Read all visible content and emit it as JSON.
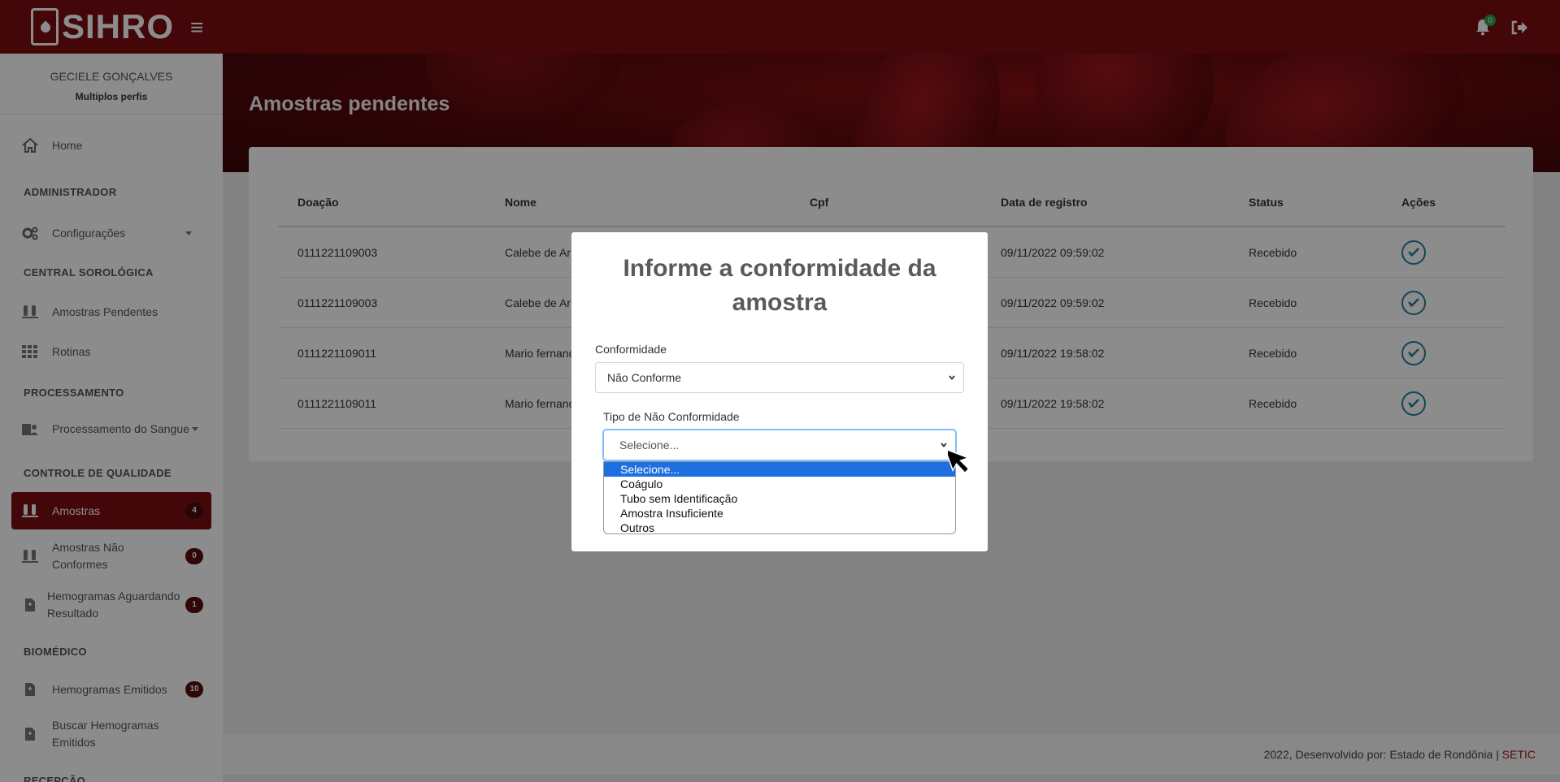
{
  "header": {
    "logo_text": "SIHRO",
    "notification_count": "0"
  },
  "sidebar": {
    "user_name": "GECIELE GONÇALVES",
    "user_role": "Multiplos perfis",
    "home": "Home",
    "sections": {
      "admin": "ADMINISTRADOR",
      "central": "CENTRAL SOROLÓGICA",
      "processamento": "PROCESSAMENTO",
      "controle": "CONTROLE DE QUALIDADE",
      "biomedico": "BIOMÉDICO",
      "recepcao": "RECEPÇÃO"
    },
    "items": {
      "configuracoes": "Configurações",
      "amostras_pendentes": "Amostras Pendentes",
      "rotinas": "Rotinas",
      "processamento_sangue": "Processamento do Sangue",
      "amostras": "Amostras",
      "amostras_badge": "4",
      "amostras_nao_conformes": "Amostras Não Conformes",
      "amostras_nao_conformes_badge": "0",
      "hemogramas_aguardando": "Hemogramas Aguardando Resultado",
      "hemogramas_aguardando_badge": "1",
      "hemogramas_emitidos": "Hemogramas Emitidos",
      "hemogramas_emitidos_badge": "10",
      "buscar_hemogramas": "Buscar Hemogramas Emitidos"
    }
  },
  "main": {
    "page_title": "Amostras pendentes",
    "columns": [
      "Doação",
      "Nome",
      "Cpf",
      "Data de registro",
      "Status",
      "Ações"
    ],
    "rows": [
      {
        "doacao": "0111221109003",
        "nome": "Calebe de Ar",
        "cpf": "",
        "data": "09/11/2022 09:59:02",
        "status": "Recebido"
      },
      {
        "doacao": "0111221109003",
        "nome": "Calebe de Ar",
        "cpf": "",
        "data": "09/11/2022 09:59:02",
        "status": "Recebido"
      },
      {
        "doacao": "0111221109011",
        "nome": "Mario fernanc",
        "cpf": "",
        "data": "09/11/2022 19:58:02",
        "status": "Recebido"
      },
      {
        "doacao": "0111221109011",
        "nome": "Mario fernanc",
        "cpf": "",
        "data": "09/11/2022 19:58:02",
        "status": "Recebido"
      }
    ]
  },
  "footer": {
    "text": "2022, Desenvolvido por: Estado de Rondônia | ",
    "link": "SETIC"
  },
  "modal": {
    "title_line1": "Informe a conformidade da",
    "title_line2": "amostra",
    "conformidade_label": "Conformidade",
    "conformidade_value": "Não Conforme",
    "tipo_label": "Tipo de Não Conformidade",
    "tipo_value": "Selecione...",
    "options": [
      "Selecione...",
      "Coágulo",
      "Tubo sem Identificação",
      "Amostra Insuficiente",
      "Outros"
    ]
  },
  "colors": {
    "brand": "#7a0c11",
    "accent_icon": "#1f7fa3",
    "option_highlight": "#1e6fe0"
  }
}
